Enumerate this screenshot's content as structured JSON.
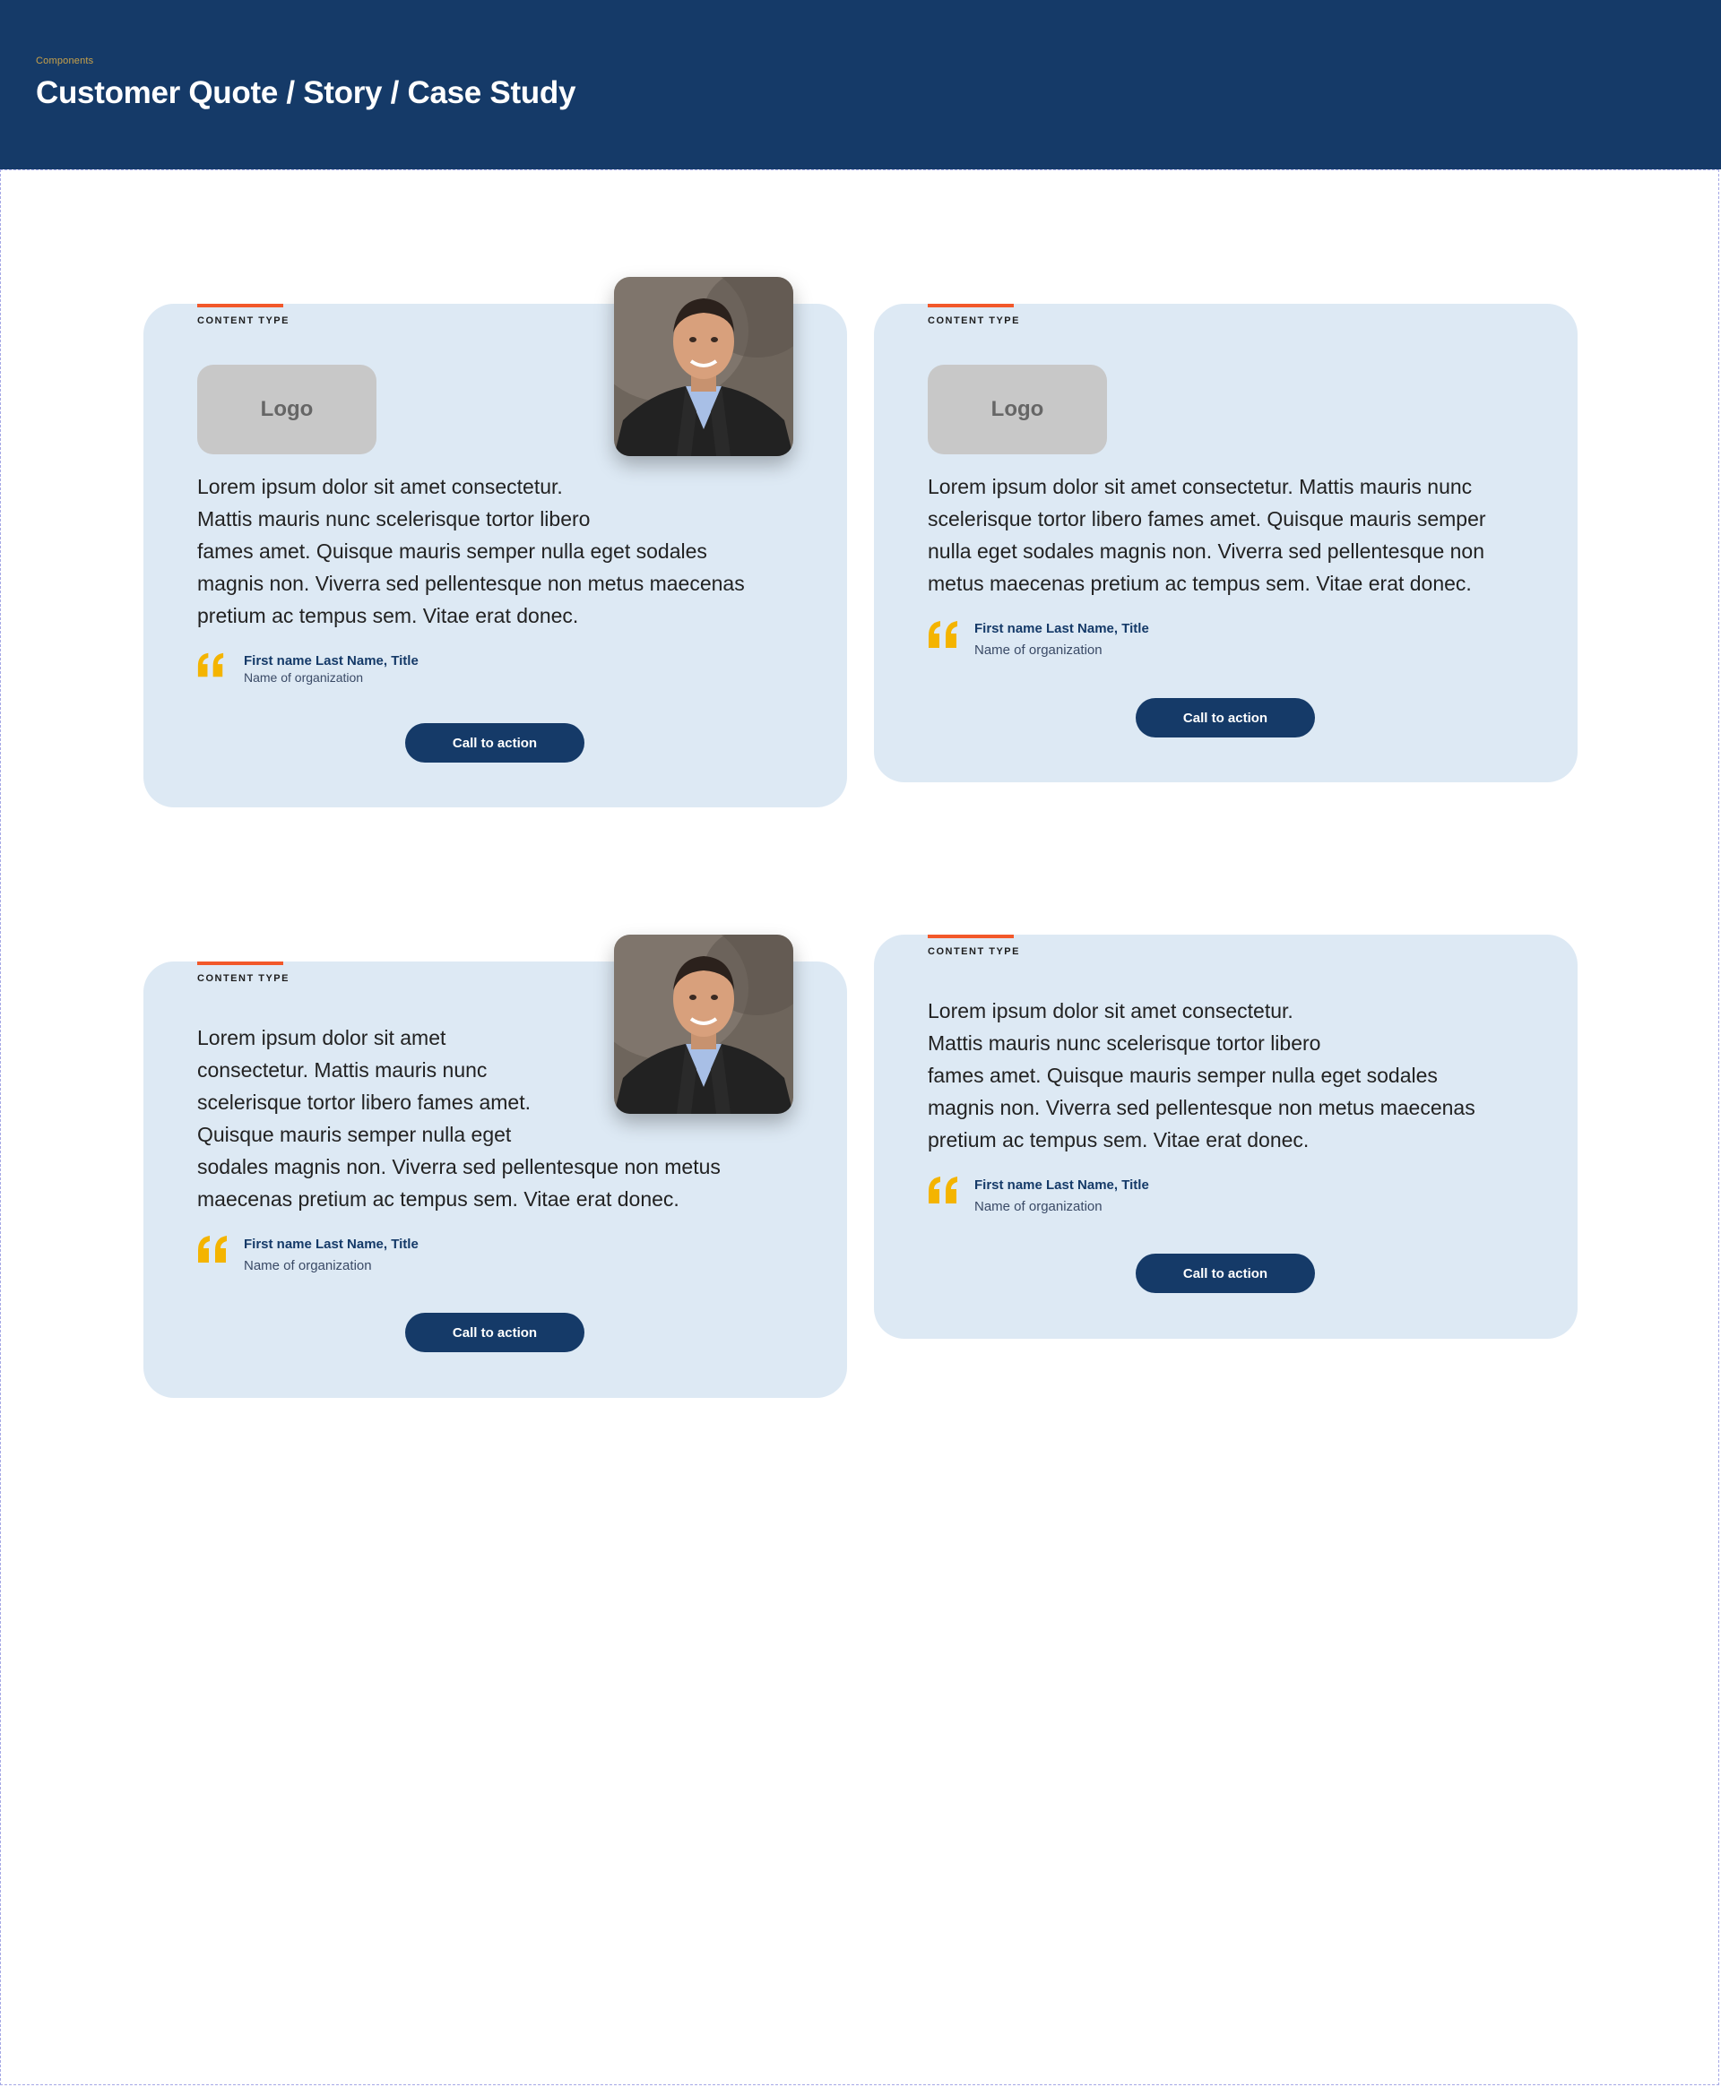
{
  "header": {
    "eyebrow": "Components",
    "title": "Customer Quote / Story / Case Study"
  },
  "colors": {
    "header_bg": "#153a68",
    "card_bg": "#dde9f4",
    "accent_bar": "#f2582a",
    "quote_mark": "#f4b400",
    "button_bg": "#153a68"
  },
  "cards": [
    {
      "content_type": "CONTENT TYPE",
      "logo": "Logo",
      "has_photo": true,
      "body_lines": [
        "Lorem ipsum dolor sit amet consectetur.",
        "Mattis mauris nunc scelerisque tortor libero",
        "fames amet. Quisque mauris semper nulla eget sodales",
        "magnis non. Viverra sed pellentesque non metus maecenas",
        "pretium ac tempus sem. Vitae erat donec."
      ],
      "attribution_name": "First name Last Name, Title",
      "attribution_org": "Name of organization",
      "cta": "Call to action",
      "quote_icon": "quote-icon"
    },
    {
      "content_type": "CONTENT TYPE",
      "logo": "Logo",
      "has_photo": false,
      "body_lines": [
        "Lorem ipsum dolor sit amet consectetur. Mattis mauris nunc",
        "scelerisque tortor libero fames amet. Quisque mauris semper",
        "nulla eget sodales magnis non. Viverra sed pellentesque non",
        "metus maecenas pretium ac tempus sem. Vitae erat donec."
      ],
      "attribution_name": "First name Last Name, Title",
      "attribution_org": "Name of organization",
      "cta": "Call to action",
      "quote_icon": "quote-icon"
    },
    {
      "content_type": "CONTENT TYPE",
      "has_photo": true,
      "body_lines": [
        "Lorem ipsum dolor sit amet",
        "consectetur. Mattis mauris nunc",
        "scelerisque tortor libero fames amet.",
        "Quisque mauris semper nulla eget",
        "sodales magnis non. Viverra sed pellentesque non metus",
        "maecenas pretium ac tempus sem. Vitae erat donec."
      ],
      "attribution_name": "First name Last Name, Title",
      "attribution_org": "Name of organization",
      "cta": "Call to action",
      "quote_icon": "quote-icon"
    },
    {
      "content_type": "CONTENT TYPE",
      "has_photo": false,
      "body_lines": [
        "Lorem ipsum dolor sit amet consectetur.",
        "Mattis mauris nunc scelerisque tortor libero",
        "fames amet. Quisque mauris semper nulla eget sodales",
        "magnis non. Viverra sed pellentesque non metus maecenas",
        "pretium ac tempus sem. Vitae erat donec."
      ],
      "attribution_name": "First name Last Name, Title",
      "attribution_org": "Name of organization",
      "cta": "Call to action",
      "quote_icon": "quote-icon"
    }
  ]
}
